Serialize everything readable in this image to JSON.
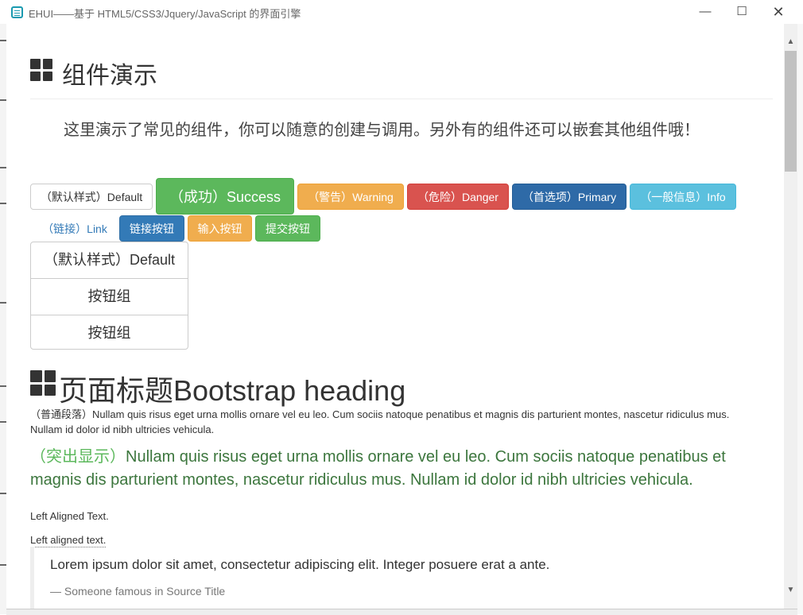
{
  "window": {
    "title": "EHUI——基于 HTML5/CSS3/Jquery/JavaScript 的界面引擎",
    "minimize_glyph": "—",
    "maximize_glyph": "☐",
    "close_glyph": "✕"
  },
  "page": {
    "heading": "组件演示",
    "lead": "这里演示了常见的组件，你可以随意的创建与调用。另外有的组件还可以嵌套其他组件哦！"
  },
  "buttons": {
    "default": "（默认样式）Default",
    "success": "（成功）Success",
    "warning": "（警告）Warning",
    "danger": "（危险）Danger",
    "primary": "（首选项）Primary",
    "info": "（一般信息）Info",
    "link": "（链接）Link",
    "link_button": "链接按钮",
    "input_button": "输入按钮",
    "submit_button": "提交按钮"
  },
  "button_group": {
    "items": [
      "（默认样式）Default",
      "按钮组",
      "按钮组"
    ]
  },
  "section": {
    "heading": "页面标题Bootstrap heading",
    "paragraph": "（普通段落）Nullam quis risus eget urna mollis ornare vel eu leo. Cum sociis natoque penatibus et magnis dis parturient montes, nascetur ridiculus mus. Nullam id dolor id nibh ultricies vehicula.",
    "highlight_prefix": "（突出显示）",
    "highlight_text": "Nullam quis risus eget urna mollis ornare vel eu leo. Cum sociis natoque penatibus et magnis dis parturient montes, nascetur ridiculus mus. Nullam id dolor id nibh ultricies vehicula.",
    "left_aligned": "Left Aligned Text.",
    "left_aligned_abbr": "Left aligned text.",
    "blockquote": "Lorem ipsum dolor sit amet, consectetur adipiscing elit. Integer posuere erat a ante.",
    "blockquote_source": "— Someone famous in Source Title"
  },
  "icons": {
    "app": "app-icon",
    "heading": "th-large-icon",
    "scroll_up": "▲",
    "scroll_down": "▼"
  },
  "colors": {
    "success": "#5cb85c",
    "warning": "#f0ad4e",
    "danger": "#d9534f",
    "primary": "#2e6aa7",
    "info": "#5bc0de",
    "link": "#337ab7",
    "highlight": "#3c763d"
  }
}
